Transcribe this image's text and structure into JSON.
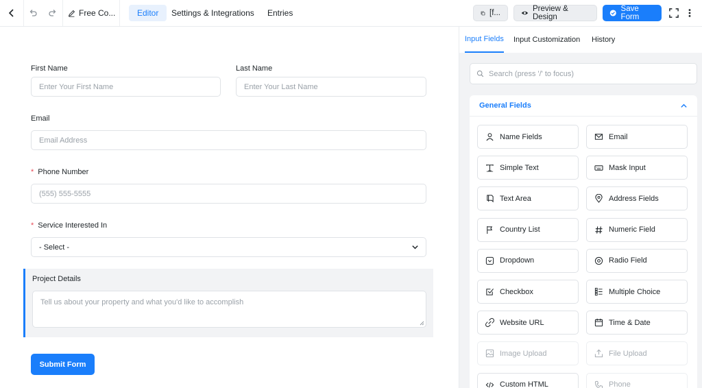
{
  "topbar": {
    "form_title": "Free Co...",
    "tabs": [
      "Editor",
      "Settings & Integrations",
      "Entries"
    ],
    "shortcode_label": "[f...",
    "preview_label": "Preview & Design",
    "save_label": "Save Form"
  },
  "form": {
    "first_name": {
      "label": "First Name",
      "placeholder": "Enter Your First Name"
    },
    "last_name": {
      "label": "Last Name",
      "placeholder": "Enter Your Last Name"
    },
    "email": {
      "label": "Email",
      "placeholder": "Email Address"
    },
    "phone": {
      "required_mark": "*",
      "label": "Phone Number",
      "placeholder": "(555) 555-5555"
    },
    "service": {
      "required_mark": "*",
      "label": "Service Interested In",
      "selected": "- Select -"
    },
    "project": {
      "label": "Project Details",
      "placeholder": "Tell us about your property and what you'd like to accomplish"
    },
    "submit_label": "Submit Form"
  },
  "sidebar": {
    "tabs": [
      "Input Fields",
      "Input Customization",
      "History"
    ],
    "search_placeholder": "Search (press '/' to focus)",
    "section_title": "General Fields",
    "fields": [
      {
        "label": "Name Fields",
        "icon": "user-icon",
        "enabled": true
      },
      {
        "label": "Email",
        "icon": "envelope-icon",
        "enabled": true
      },
      {
        "label": "Simple Text",
        "icon": "text-cursor-icon",
        "enabled": true
      },
      {
        "label": "Mask Input",
        "icon": "keyboard-icon",
        "enabled": true
      },
      {
        "label": "Text Area",
        "icon": "textarea-icon",
        "enabled": true
      },
      {
        "label": "Address Fields",
        "icon": "map-pin-icon",
        "enabled": true
      },
      {
        "label": "Country List",
        "icon": "flag-icon",
        "enabled": true
      },
      {
        "label": "Numeric Field",
        "icon": "hash-icon",
        "enabled": true
      },
      {
        "label": "Dropdown",
        "icon": "dropdown-icon",
        "enabled": true
      },
      {
        "label": "Radio Field",
        "icon": "radio-icon",
        "enabled": true
      },
      {
        "label": "Checkbox",
        "icon": "checkbox-icon",
        "enabled": true
      },
      {
        "label": "Multiple Choice",
        "icon": "list-icon",
        "enabled": true
      },
      {
        "label": "Website URL",
        "icon": "link-icon",
        "enabled": true
      },
      {
        "label": "Time & Date",
        "icon": "calendar-icon",
        "enabled": true
      },
      {
        "label": "Image Upload",
        "icon": "image-icon",
        "enabled": false
      },
      {
        "label": "File Upload",
        "icon": "upload-icon",
        "enabled": false
      },
      {
        "label": "Custom HTML",
        "icon": "code-icon",
        "enabled": true
      },
      {
        "label": "Phone",
        "icon": "phone-icon",
        "enabled": false
      }
    ]
  },
  "colors": {
    "accent": "#1a7efb",
    "required": "#e84a57",
    "sidebar_bg": "#f2f3f5"
  }
}
